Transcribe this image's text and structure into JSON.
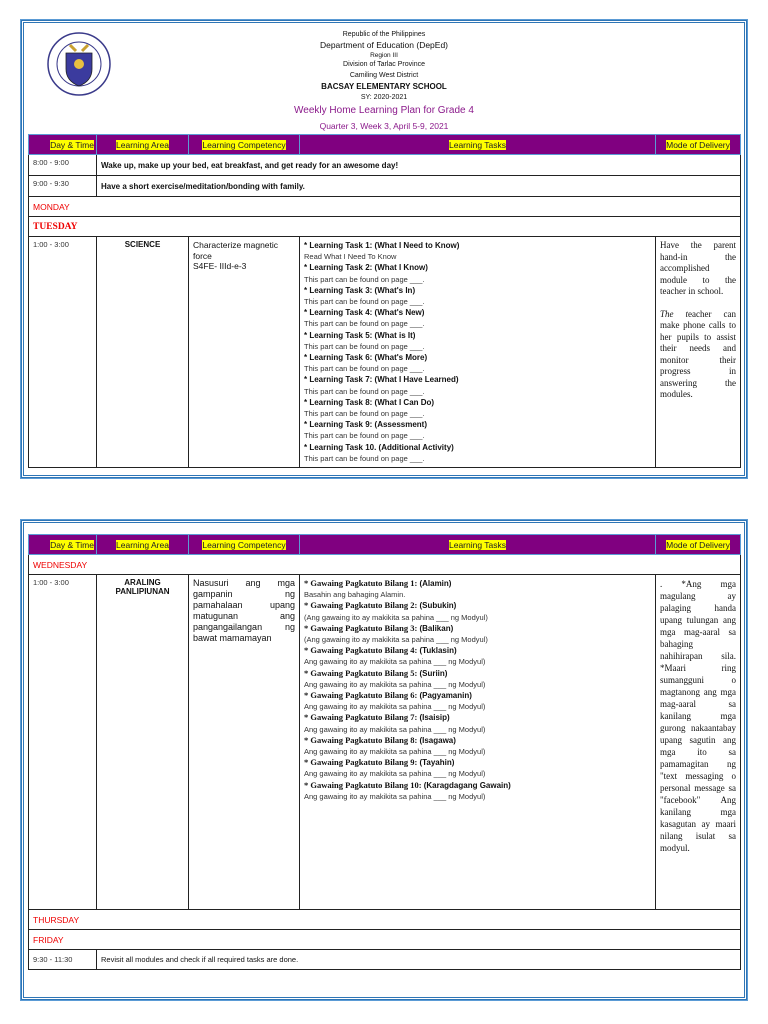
{
  "header": {
    "line1": "Republic of the Philippines",
    "line2": "Department of Education (DepEd)",
    "line3": "Region III",
    "line4": "Division of Tarlac Province",
    "line5": "Camiling West District",
    "school": "BACSAY ELEMENTARY SCHOOL",
    "sy": "SY: 2020-2021",
    "title": "Weekly Home Learning Plan for Grade 4",
    "subtitle": "Quarter 3, Week 3, April 5-9, 2021",
    "logo_text": "KAGAWARAN NG EDUKASYON · REPUBLIKA NG PILIPINAS"
  },
  "columns": [
    "Day & Time",
    "Learning Area",
    "Learning Competency",
    "Learning Tasks",
    "Mode of Delivery"
  ],
  "page1": {
    "routine": [
      {
        "time": "8:00 - 9:00",
        "text": "Wake up, make up your bed, eat breakfast, and get ready for an awesome day!"
      },
      {
        "time": "9:00 - 9:30",
        "text": "Have a short exercise/meditation/bonding with family."
      }
    ],
    "monday": "MONDAY",
    "tuesday": "TUESDAY",
    "science": {
      "time": "1:00 - 3:00",
      "area": "SCIENCE",
      "competency": "Characterize magnetic force",
      "code": "S4FE- IIId-e-3",
      "tasks": [
        {
          "title": "* Learning Task 1: (What I Need to Know)",
          "note": "Read What I Need To Know"
        },
        {
          "title": "* Learning Task 2: (What I Know)",
          "note": "This part can be found on page ___."
        },
        {
          "title": "* Learning Task 3: (What's In)",
          "note": "This part can be found on page ___."
        },
        {
          "title": "* Learning Task 4: (What's New)",
          "note": "This part can be found on page ___."
        },
        {
          "title": "* Learning Task 5: (What is It)",
          "note": "This part can be found on page ___."
        },
        {
          "title": "* Learning Task 6: (What's More)",
          "note": "This part can be found on page ___."
        },
        {
          "title": "* Learning Task 7: (What I Have Learned)",
          "note": "This part can be found on page ___."
        },
        {
          "title": "* Learning Task 8: (What I Can Do)",
          "note": "This part can be found on page ___."
        },
        {
          "title": "* Learning Task 9: (Assessment)",
          "note": "This part can be found on page ___."
        },
        {
          "title": "* Learning Task 10. (Additional Activity)",
          "note": "This part can be found on page ___."
        }
      ],
      "mode1": "Have the parent hand-in the accomplished module to the teacher in school.",
      "mode2_em": "The t",
      "mode2": "eacher can make phone calls to her pupils to assist their needs and monitor their progress in answering the modules."
    }
  },
  "page2": {
    "wednesday": "WEDNESDAY",
    "thursday": "THURSDAY",
    "friday": "FRIDAY",
    "ap": {
      "time": "1:00 - 3:00",
      "area": "ARALING PANLIPIUNAN",
      "competency": "Nasusuri ang mga gampanin ng pamahalaan upang matugunan ang pangangailangan ng bawat mamamayan",
      "tasks": [
        {
          "title": "* Gawaing Pagkatuto Bilang 1:",
          "sub": "(Alamin)",
          "note": "Basahin ang bahaging Alamin."
        },
        {
          "title": "* Gawaing Pagkatuto Bilang 2:",
          "sub": "(Subukin)",
          "note": "(Ang gawaing ito ay makikita sa pahina ___ ng Modyul)"
        },
        {
          "title": "* Gawaing Pagkatuto Bilang 3:",
          "sub": "(Balikan)",
          "note": "(Ang gawaing ito ay makikita sa pahina ___ ng Modyul)"
        },
        {
          "title": "* Gawaing Pagkatuto Bilang 4:",
          "sub": "(Tuklasin)",
          "note": "Ang gawaing ito ay makikita sa pahina ___ ng Modyul)"
        },
        {
          "title": "* Gawaing Pagkatuto Bilang 5:",
          "sub": "(Suriin)",
          "note": "Ang gawaing ito ay makikita sa pahina ___ ng Modyul)"
        },
        {
          "title": "* Gawaing Pagkatuto Bilang 6:",
          "sub": "(Pagyamanin)",
          "note": "Ang gawaing ito ay makikita sa pahina ___ ng Modyul)"
        },
        {
          "title": "* Gawaing Pagkatuto Bilang 7:",
          "sub": "(Isaisip)",
          "note": "Ang gawaing ito ay makikita sa pahina ___ ng Modyul)"
        },
        {
          "title": "* Gawaing Pagkatuto Bilang 8:",
          "sub": "(Isagawa)",
          "note": "Ang gawaing ito ay makikita sa pahina ___ ng Modyul)"
        },
        {
          "title": "* Gawaing Pagkatuto Bilang 9:",
          "sub": "(Tayahin)",
          "note": "Ang gawaing ito ay makikita sa pahina ___ ng Modyul)"
        },
        {
          "title": "* Gawaing Pagkatuto Bilang 10:",
          "sub": "(Karagdagang Gawain)",
          "note": "Ang gawaing ito ay makikita sa pahina ___ ng Modyul)"
        }
      ],
      "mode": ". *Ang mga magulang ay palaging handa upang tulungan ang mga mag-aaral sa bahaging nahihirapan sila. *Maari ring sumangguni o magtanong ang mga mag-aaral sa kanilang mga gurong nakaantabay upang sagutin ang mga ito sa pamamagitan ng \"text messaging o personal message sa \"facebook\" Ang kanilang mga kasagutan ay maari nilang isulat sa modyul."
    },
    "friday_row": {
      "time": "9:30 - 11:30",
      "text": "Revisit all modules and check if all required tasks are done."
    }
  }
}
